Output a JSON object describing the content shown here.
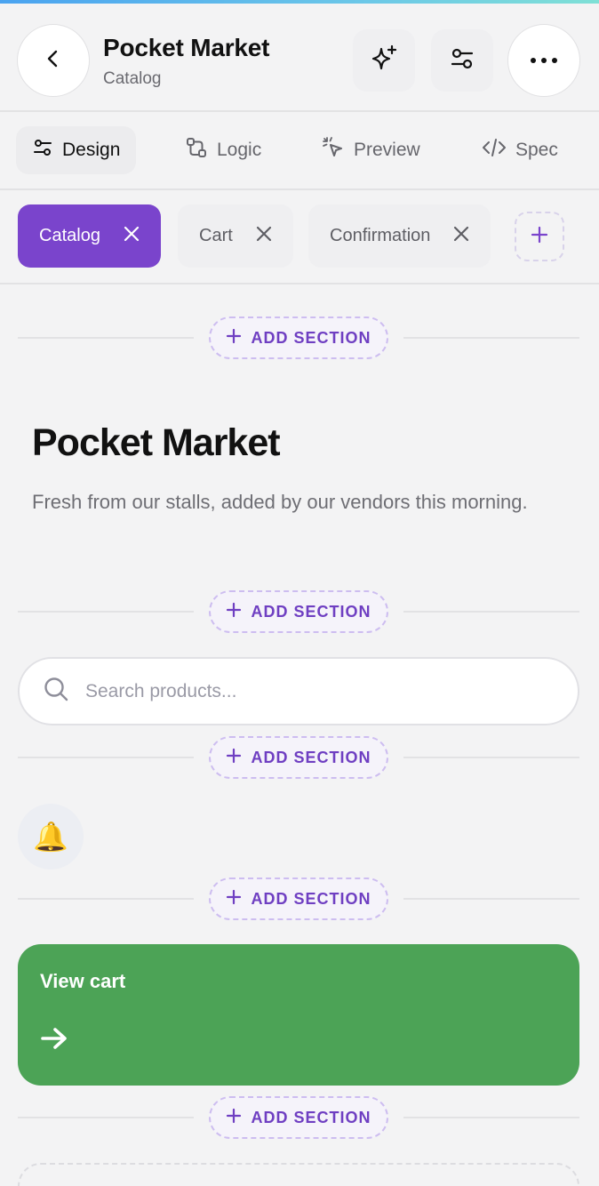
{
  "colors": {
    "accent": "#7a44cc",
    "cta_background": "#4ca356",
    "background": "#f3f3f4"
  },
  "header": {
    "title": "Pocket Market",
    "subtitle": "Catalog",
    "back_icon": "chevron-left-icon",
    "ai_icon": "sparkle-icon",
    "settings_icon": "sliders-icon",
    "more_icon": "more-horizontal-icon"
  },
  "modes": [
    {
      "label": "Design",
      "icon": "sliders-icon",
      "active": true
    },
    {
      "label": "Logic",
      "icon": "logic-flow-icon",
      "active": false
    },
    {
      "label": "Preview",
      "icon": "cursor-click-icon",
      "active": false
    },
    {
      "label": "Spec",
      "icon": "code-icon",
      "active": false
    }
  ],
  "pages": [
    {
      "label": "Catalog",
      "active": true
    },
    {
      "label": "Cart",
      "active": false
    },
    {
      "label": "Confirmation",
      "active": false
    }
  ],
  "add_section_label": "ADD SECTION",
  "hero": {
    "title": "Pocket Market",
    "description": "Fresh from our stalls, added by our vendors this morning."
  },
  "search": {
    "placeholder": "Search products...",
    "value": ""
  },
  "bell": {
    "glyph": "🔔"
  },
  "cta": {
    "label": "View cart"
  }
}
